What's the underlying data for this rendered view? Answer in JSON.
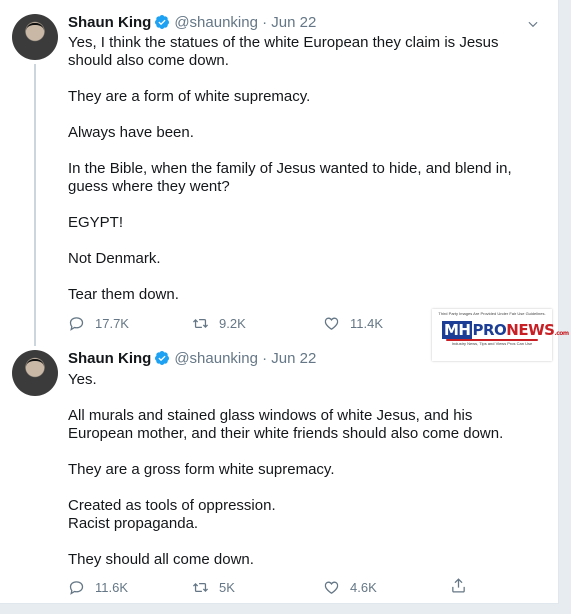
{
  "colors": {
    "verified_blue": "#1da1f2",
    "meta_gray": "#657786",
    "page_bg": "#e6ecf0"
  },
  "tweets": [
    {
      "name": "Shaun King",
      "handle": "@shaunking",
      "dot": "·",
      "date": "Jun 22",
      "paragraphs": [
        "Yes, I think the statues of the white European they claim is Jesus should also come down.",
        "They are a form of white supremacy.",
        "Always have been.",
        "In the Bible, when the family of Jesus wanted to hide, and blend in, guess where they went?",
        "EGYPT!",
        "Not Denmark.",
        "Tear them down."
      ],
      "replies": "17.7K",
      "retweets": "9.2K",
      "likes": "11.4K"
    },
    {
      "name": "Shaun King",
      "handle": "@shaunking",
      "dot": "·",
      "date": "Jun 22",
      "paragraphs": [
        "Yes.",
        "All murals and stained glass windows of white Jesus, and his European mother, and their white friends should also come down.",
        "They are a gross form white supremacy.",
        "Created as tools of oppression.\nRacist propaganda.",
        "They should all come down."
      ],
      "replies": "11.6K",
      "retweets": "5K",
      "likes": "4.6K"
    }
  ],
  "watermark": {
    "top_text": "Third Party Images Are Provided Under Fair Use Guidelines.",
    "mh": "MH",
    "pro": "PRO",
    "news": "NEWS",
    "com": ".com",
    "bottom_text": "Industry News, Tips and Views Pros Can Use"
  }
}
